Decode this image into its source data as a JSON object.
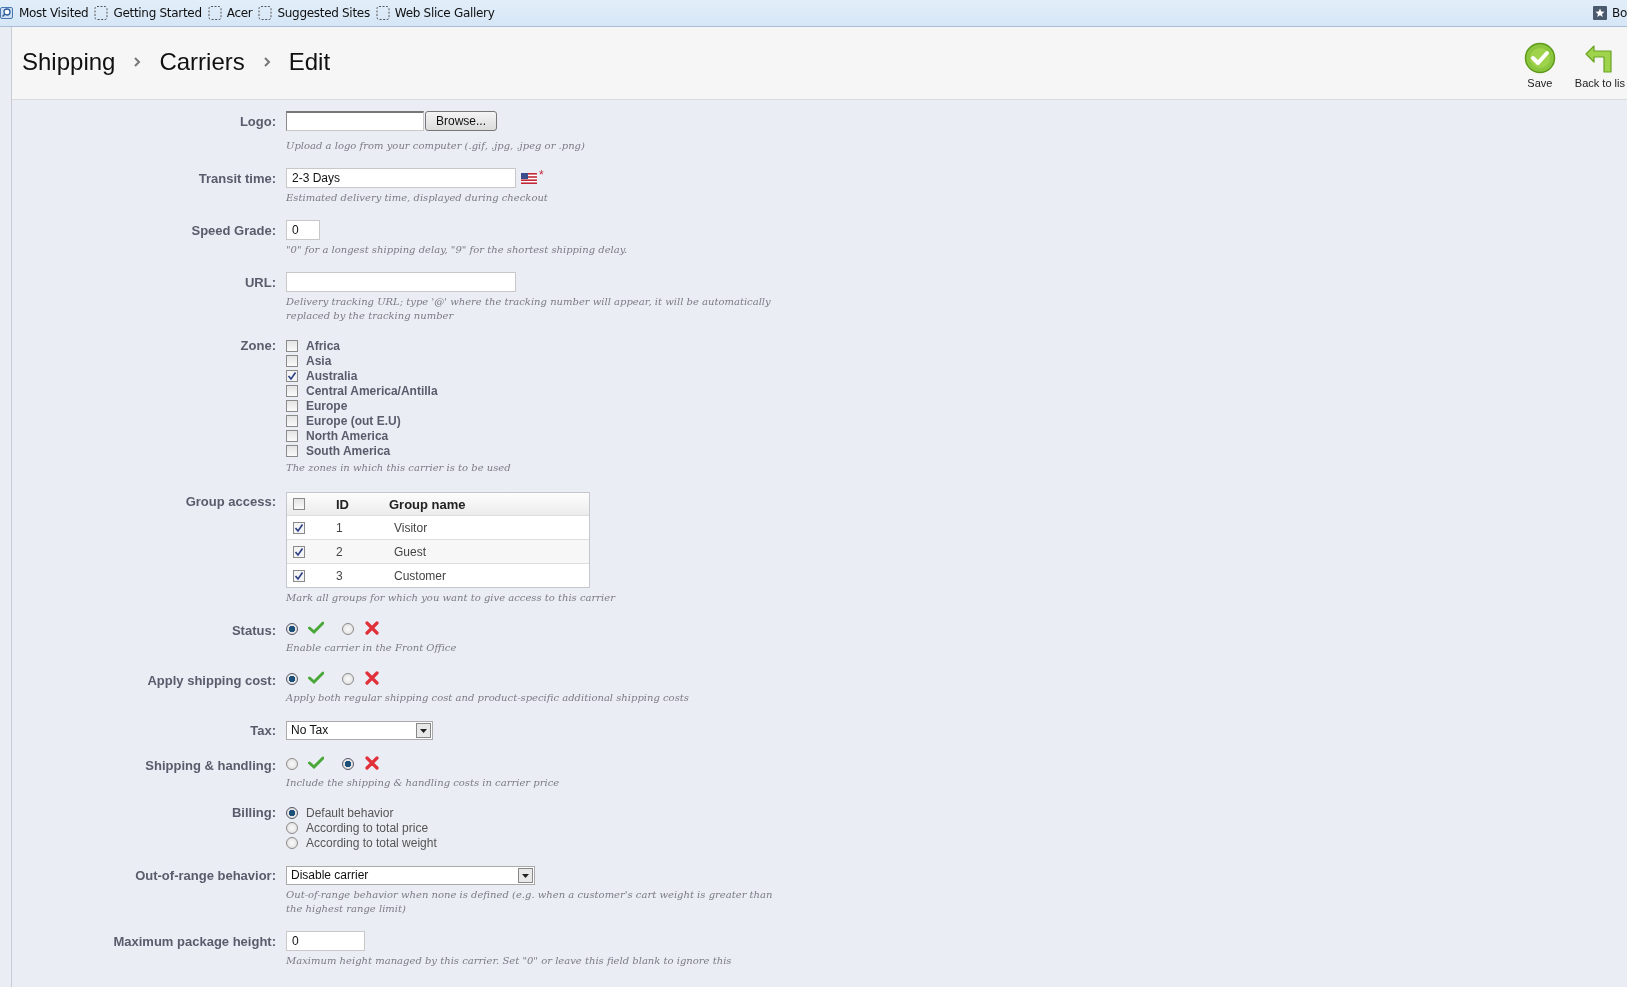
{
  "bookmarks": {
    "items": [
      {
        "label": "Most Visited",
        "kind": "history"
      },
      {
        "label": "Getting Started",
        "kind": "page"
      },
      {
        "label": "Acer",
        "kind": "page"
      },
      {
        "label": "Suggested Sites",
        "kind": "page"
      },
      {
        "label": "Web Slice Gallery",
        "kind": "page"
      }
    ],
    "menu": {
      "label": "Bo"
    }
  },
  "header": {
    "breadcrumb": [
      "Shipping",
      "Carriers",
      "Edit"
    ],
    "actions": [
      {
        "label": "Save",
        "kind": "save"
      },
      {
        "label": "Back to lis",
        "kind": "back"
      }
    ]
  },
  "form": [
    {
      "kind": "file",
      "label": "Logo:",
      "button": "Browse...",
      "hints": [
        "Upload a logo from your computer (.gif, .jpg, .jpeg or .png)"
      ]
    },
    {
      "kind": "text",
      "label": "Transit time:",
      "value": "2-3 Days",
      "flag": true,
      "required_mark": "*",
      "hints": [
        "Estimated delivery time, displayed during checkout"
      ]
    },
    {
      "kind": "text",
      "label": "Speed Grade:",
      "value": "0",
      "hints": [
        "\"0\" for a longest shipping delay, \"9\" for the shortest shipping delay."
      ]
    },
    {
      "kind": "text",
      "label": "URL:",
      "hints": [
        "Delivery tracking URL; type '@' where the tracking number will appear, it will be automatically replaced by the tracking number"
      ]
    },
    {
      "kind": "checklist",
      "label": "Zone:",
      "options": [
        {
          "label": "Africa",
          "checked": false
        },
        {
          "label": "Asia",
          "checked": false
        },
        {
          "label": "Australia",
          "checked": true
        },
        {
          "label": "Central America/Antilla",
          "checked": false
        },
        {
          "label": "Europe",
          "checked": false
        },
        {
          "label": "Europe (out E.U)",
          "checked": false
        },
        {
          "label": "North America",
          "checked": false
        },
        {
          "label": "South America",
          "checked": false
        }
      ],
      "hints": [
        "The zones in which this carrier is to be used"
      ]
    },
    {
      "kind": "table",
      "label": "Group access:",
      "all_checked": false,
      "columns": [
        "ID",
        "Group name"
      ],
      "rows": [
        {
          "id": "1",
          "name": "Visitor",
          "checked": true
        },
        {
          "id": "2",
          "name": "Guest",
          "checked": true
        },
        {
          "id": "3",
          "name": "Customer",
          "checked": true
        }
      ],
      "hints": [
        "Mark all groups for which you want to give access to this carrier"
      ]
    },
    {
      "kind": "toggle",
      "label": "Status:",
      "options": [
        {
          "kind": "yes",
          "selected": true
        },
        {
          "kind": "no",
          "selected": false
        }
      ],
      "hints": [
        "Enable carrier in the Front Office"
      ]
    },
    {
      "kind": "toggle",
      "label": "Apply shipping cost:",
      "options": [
        {
          "kind": "yes",
          "selected": true
        },
        {
          "kind": "no",
          "selected": false
        }
      ],
      "hints": [
        "Apply both regular shipping cost and product-specific additional shipping costs"
      ]
    },
    {
      "kind": "select",
      "label": "Tax:",
      "value": "No Tax"
    },
    {
      "kind": "toggle",
      "label": "Shipping & handling:",
      "options": [
        {
          "kind": "yes",
          "selected": false
        },
        {
          "kind": "no",
          "selected": true
        }
      ],
      "hints": [
        "Include the shipping & handling costs in carrier price"
      ]
    },
    {
      "kind": "radios",
      "label": "Billing:",
      "options": [
        {
          "label": "Default behavior",
          "selected": true
        },
        {
          "label": "According to total price",
          "selected": false
        },
        {
          "label": "According to total weight",
          "selected": false
        }
      ]
    },
    {
      "kind": "select",
      "label": "Out-of-range behavior:",
      "value": "Disable carrier",
      "hints": [
        "Out-of-range behavior when none is defined (e.g. when a customer's cart weight is greater than the highest range limit)"
      ]
    },
    {
      "kind": "text",
      "label": "Maximum package height:",
      "value": "0",
      "hints": [
        "Maximum height managed by this carrier. Set \"0\" or leave this field blank to ignore this"
      ]
    }
  ]
}
